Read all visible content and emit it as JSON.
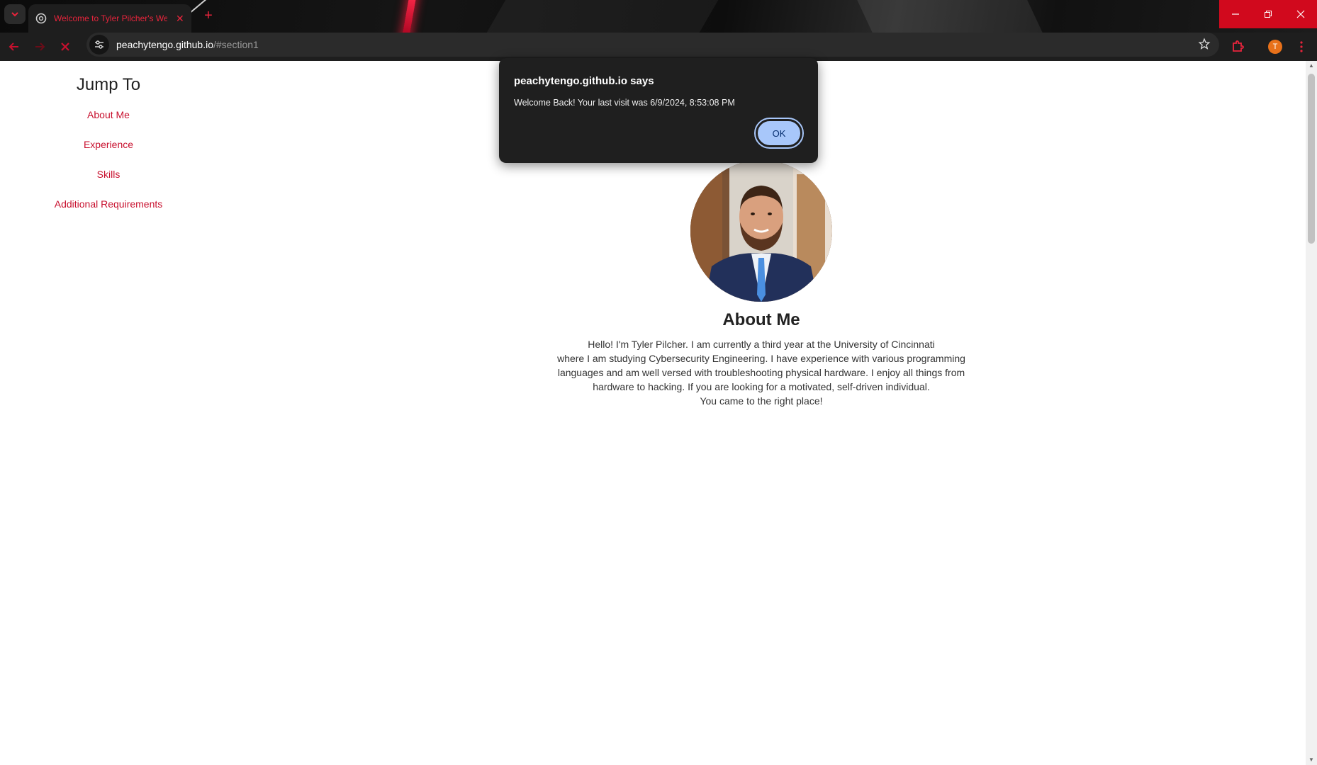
{
  "browser": {
    "tab_title": "Welcome to Tyler Pilcher's Web",
    "new_tab_label": "+",
    "url_host": "peachytengo.github.io",
    "url_path": "/#section1",
    "profile_initial": "T",
    "accent_color": "#e8243c"
  },
  "sidenav": {
    "heading": "Jump To",
    "links": [
      "About Me",
      "Experience",
      "Skills",
      "Additional Requirements"
    ]
  },
  "main": {
    "heading": "About Me",
    "bio_lines": [
      "Hello! I'm Tyler Pilcher. I am currently a third year at the University of Cincinnati",
      "where I am studying Cybersecurity Engineering. I have experience with various programming",
      "languages and am well versed with troubleshooting physical hardware. I enjoy all things from",
      "hardware to hacking. If you are looking for a motivated, self-driven individual.",
      "You came to the right place!"
    ]
  },
  "dialog": {
    "title": "peachytengo.github.io says",
    "message": "Welcome Back! Your last visit was 6/9/2024, 8:53:08 PM",
    "ok_label": "OK"
  }
}
